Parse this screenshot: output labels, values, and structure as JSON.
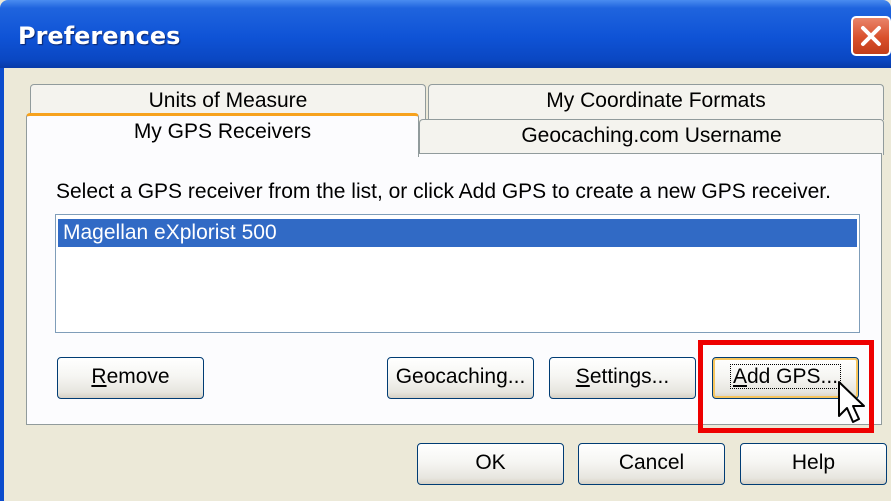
{
  "window": {
    "title": "Preferences"
  },
  "tabs": {
    "units": "Units of Measure",
    "coordinate_formats": "My Coordinate Formats",
    "gps_receivers": "My GPS Receivers",
    "username": "Geocaching.com Username",
    "active": "My GPS Receivers"
  },
  "panel": {
    "instruction": "Select a GPS receiver from the list, or click Add GPS to create a new GPS receiver.",
    "receivers": [
      "Magellan eXplorist 500"
    ],
    "selected_receiver": "Magellan eXplorist 500"
  },
  "buttons": {
    "remove_accel": "R",
    "remove_rest": "emove",
    "geocaching": "Geocaching...",
    "settings_accel": "S",
    "settings_rest": "ettings...",
    "addgps_accel": "A",
    "addgps_rest": "dd GPS...",
    "ok": "OK",
    "cancel": "Cancel",
    "help": "Help"
  },
  "colors": {
    "titlebar": "#0a47c2",
    "selection": "#316ac5",
    "highlight": "#ee0000",
    "tab_accent": "#f7a21d"
  }
}
